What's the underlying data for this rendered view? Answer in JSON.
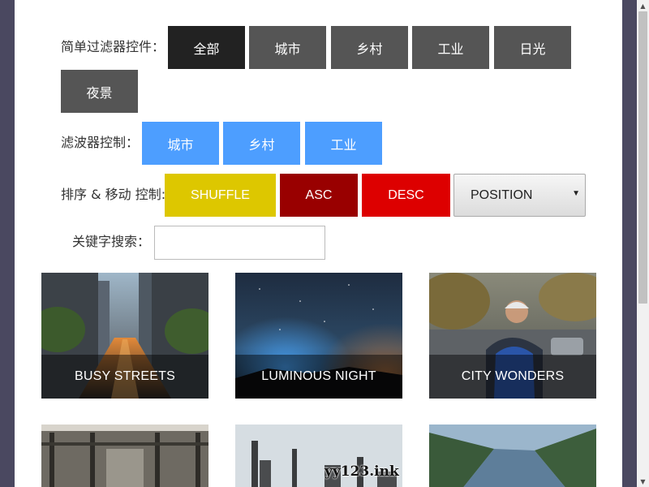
{
  "filters": {
    "simple_label": "简单过滤器控件：",
    "simple_buttons": [
      "全部",
      "城市",
      "乡村",
      "工业",
      "日光",
      "夜景"
    ],
    "multi_label": "滤波器控制：",
    "multi_buttons": [
      "城市",
      "乡村",
      "工业"
    ]
  },
  "sort": {
    "label": "排序 & 移动 控制:",
    "shuffle": "SHUFFLE",
    "asc": "ASC",
    "desc": "DESC",
    "select_value": "POSITION"
  },
  "search": {
    "label": "关键字搜索：",
    "value": "",
    "placeholder": ""
  },
  "gallery": {
    "cards": [
      {
        "caption": "BUSY STREETS"
      },
      {
        "caption": "LUMINOUS NIGHT"
      },
      {
        "caption": "CITY WONDERS"
      }
    ]
  },
  "watermark": "yy123.ink",
  "colors": {
    "page_bg": "#4a4860",
    "btn_dark": "#555555",
    "btn_active": "#222222",
    "btn_blue": "#4d9eff",
    "btn_yellow": "#ddc700",
    "btn_darkred": "#990000",
    "btn_red": "#dd0000"
  }
}
